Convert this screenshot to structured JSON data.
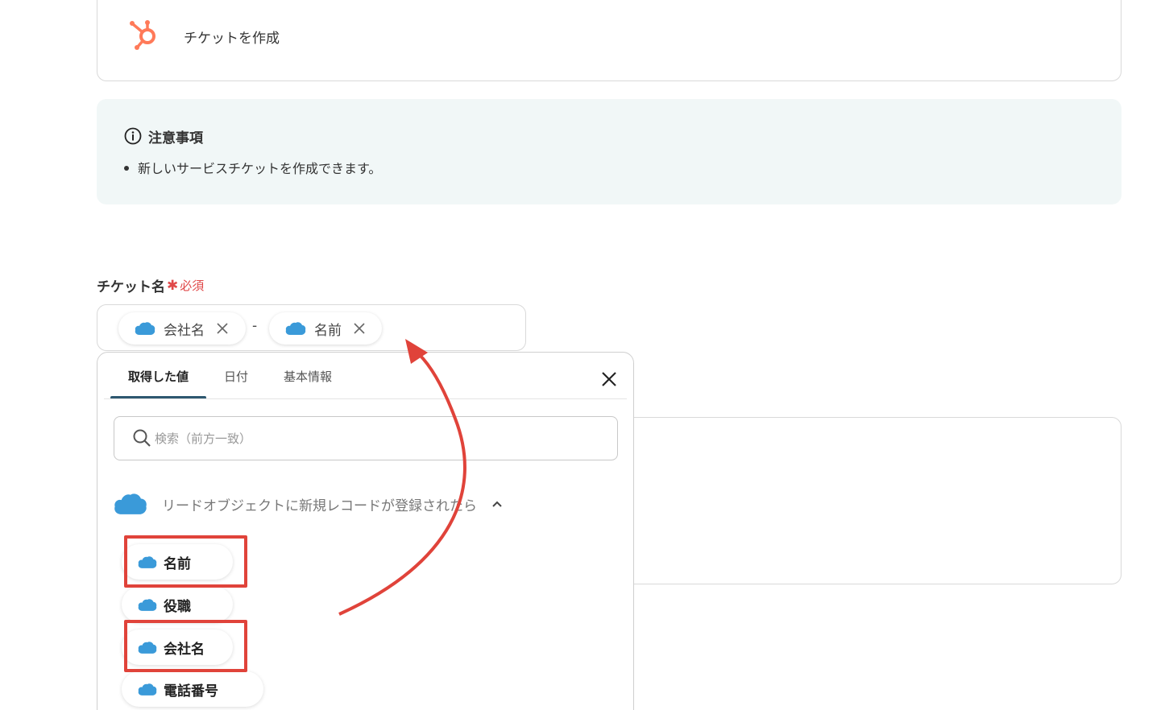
{
  "app_card": {
    "action_label": "チケットを作成",
    "icon": "hubspot-icon",
    "icon_color": "#ff7a59"
  },
  "notice": {
    "title": "注意事項",
    "icon": "info-icon",
    "items": [
      "新しいサービスチケットを作成できます。"
    ],
    "background": "#f1f7f7"
  },
  "field": {
    "label": "チケット名",
    "required_label": "必須",
    "required_color": "#e0494a",
    "chips": [
      {
        "icon": "salesforce-icon",
        "label": "会社名"
      },
      {
        "icon": "salesforce-icon",
        "label": "名前"
      }
    ],
    "separator": "-"
  },
  "picker": {
    "tabs": [
      {
        "label": "取得した値",
        "active": true
      },
      {
        "label": "日付",
        "active": false
      },
      {
        "label": "基本情報",
        "active": false
      }
    ],
    "search_placeholder": "検索（前方一致）",
    "group": {
      "title": "リードオブジェクトに新規レコードが登録されたら",
      "expanded": true,
      "items": [
        {
          "label": "名前",
          "highlighted": true
        },
        {
          "label": "役職",
          "highlighted": false
        },
        {
          "label": "会社名",
          "highlighted": true
        },
        {
          "label": "電話番号",
          "highlighted": false
        }
      ]
    },
    "tab_underline_color": "#2e5870"
  },
  "annotation": {
    "highlight_color": "#e0433a",
    "arrow_color": "#e0433a"
  },
  "salesforce_color": "#3a9ad9"
}
